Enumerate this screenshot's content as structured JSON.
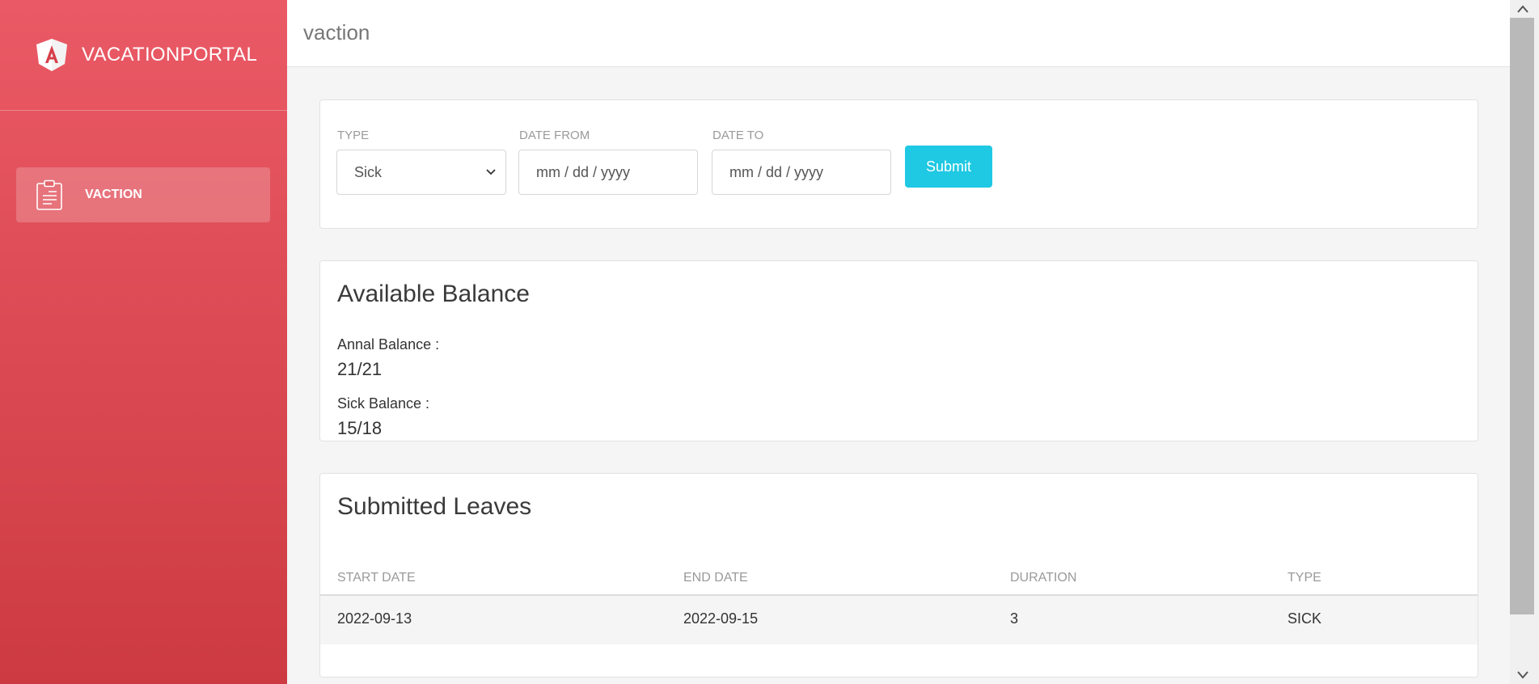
{
  "sidebar": {
    "brand": "VACATIONPORTAL",
    "logo_icon": "angular-logo-icon",
    "items": [
      {
        "label": "VACTION",
        "icon": "clipboard-icon",
        "active": true
      }
    ]
  },
  "topbar": {
    "title": "vaction"
  },
  "form": {
    "type": {
      "label": "TYPE",
      "value": "Sick"
    },
    "date_from": {
      "label": "DATE FROM",
      "value": "mm / dd / yyyy"
    },
    "date_to": {
      "label": "DATE TO",
      "value": "mm / dd / yyyy"
    },
    "submit_label": "Submit"
  },
  "balance": {
    "title": "Available Balance",
    "annual_label": "Annal Balance :",
    "annual_value": "21/21",
    "sick_label": "Sick Balance :",
    "sick_value": "15/18"
  },
  "leaves": {
    "title": "Submitted Leaves",
    "columns": [
      "START DATE",
      "END DATE",
      "DURATION",
      "TYPE"
    ],
    "rows": [
      [
        "2022-09-13",
        "2022-09-15",
        "3",
        "SICK"
      ]
    ]
  },
  "colors": {
    "sidebar_top": "#ea5a66",
    "sidebar_bottom": "#cd3a41",
    "accent": "#1fc8e3"
  }
}
